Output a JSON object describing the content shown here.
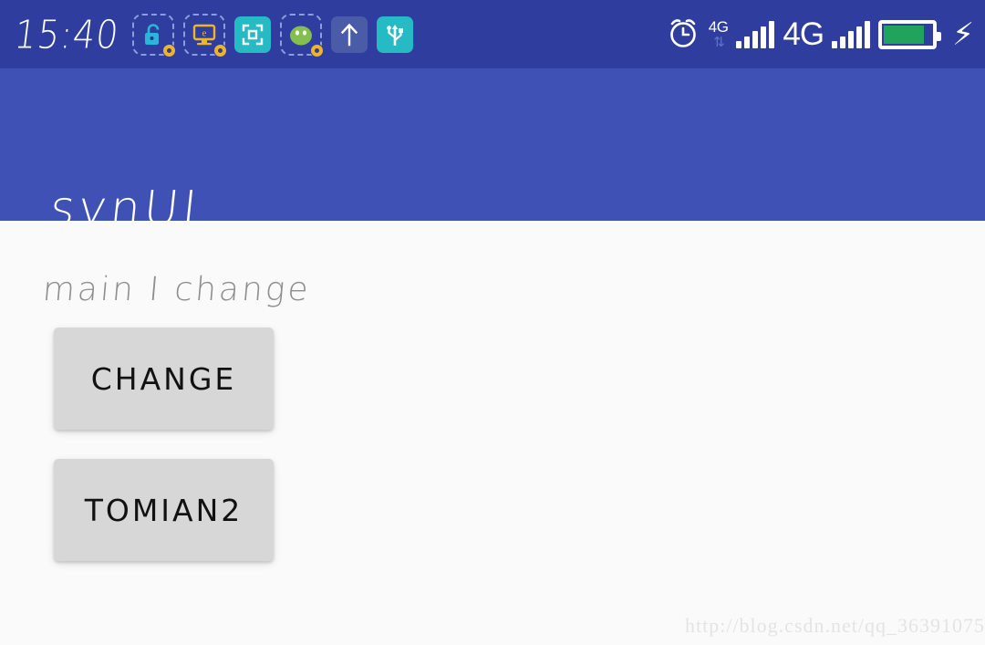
{
  "status_bar": {
    "time": "15:40",
    "background_color": "#2f3e9e",
    "left_icons": [
      {
        "name": "unlocked-padlock-icon",
        "glyph": "🔓",
        "badge": "gear"
      },
      {
        "name": "monitor-e-icon",
        "glyph": "🖵",
        "badge": "gear"
      },
      {
        "name": "screenshot-crop-icon",
        "glyph": "⬚",
        "badge": "none"
      },
      {
        "name": "android-blob-icon",
        "glyph": "●",
        "badge": "gear"
      },
      {
        "name": "upload-arrow-icon",
        "glyph": "↑",
        "badge": "none"
      },
      {
        "name": "usb-icon",
        "glyph": "⑇",
        "badge": "none"
      }
    ],
    "right": {
      "alarm_icon": "alarm-clock-icon",
      "network_small_label": "4G",
      "network_arrows": "⇅",
      "network_big_label": "4G",
      "signal_1_bars": 5,
      "signal_2_bars": 5,
      "battery_percent": 85,
      "battery_color": "#22a35b",
      "charging": true
    }
  },
  "app_bar": {
    "title": "synUI",
    "background_color": "#3f51b5",
    "title_color": "#ffffff"
  },
  "content": {
    "background_color": "#fafafa",
    "status_label": "main I change",
    "status_label_color": "#8e8e8e",
    "buttons": [
      {
        "name": "change-button",
        "label": "CHANGE"
      },
      {
        "name": "tomian2-button",
        "label": "TOMIAN2"
      }
    ],
    "button_color": "#d7d7d7"
  },
  "watermark": {
    "text": "http://blog.csdn.net/qq_36391075",
    "color": "#e4e4e4"
  }
}
